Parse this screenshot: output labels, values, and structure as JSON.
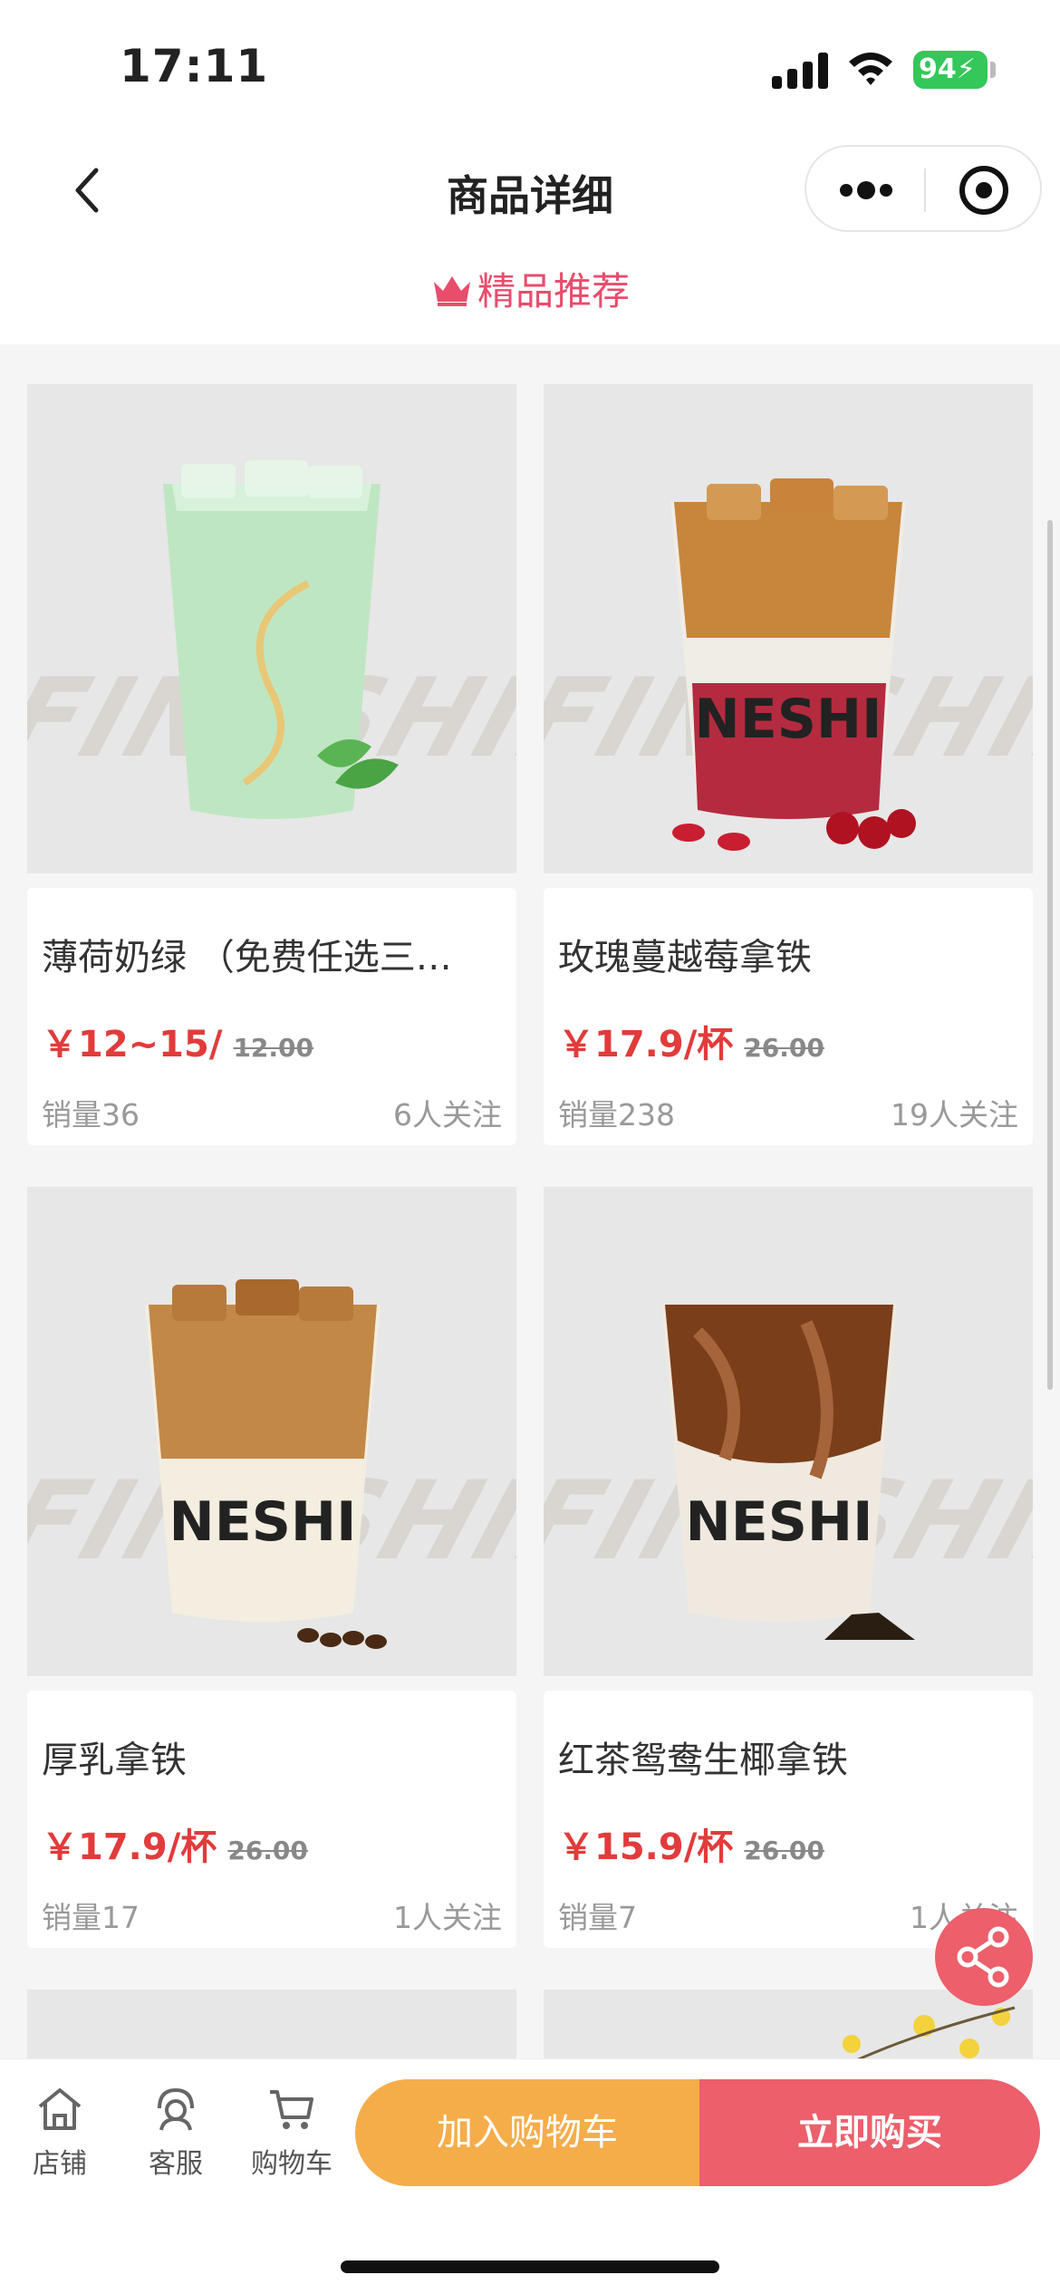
{
  "status": {
    "time": "17:11",
    "battery": "94"
  },
  "nav": {
    "title": "商品详细"
  },
  "recommend": {
    "label": "精品推荐"
  },
  "products": [
    {
      "name": "薄荷奶绿 （免费任选三…",
      "price": "￥12~15/",
      "original": "12.00",
      "sales": "销量36",
      "follow": "6人关注",
      "drink": "mint"
    },
    {
      "name": "玫瑰蔓越莓拿铁",
      "price": "￥17.9/杯",
      "original": "26.00",
      "sales": "销量238",
      "follow": "19人关注",
      "drink": "rose"
    },
    {
      "name": "厚乳拿铁",
      "price": "￥17.9/杯",
      "original": "26.00",
      "sales": "销量17",
      "follow": "1人关注",
      "drink": "latte"
    },
    {
      "name": "红茶鸳鸯生椰拿铁",
      "price": "￥15.9/杯",
      "original": "26.00",
      "sales": "销量7",
      "follow": "1人关注",
      "drink": "tea"
    }
  ],
  "brand": {
    "band": "FINESHINE",
    "cup_text": "NESHI"
  },
  "bottom": {
    "store": "店铺",
    "service": "客服",
    "cart": "购物车",
    "add_to_cart": "加入购物车",
    "buy_now": "立即购买"
  },
  "colors": {
    "accent": "#ec5f6b",
    "orange": "#f5ad4a",
    "price": "#e23b3b"
  }
}
